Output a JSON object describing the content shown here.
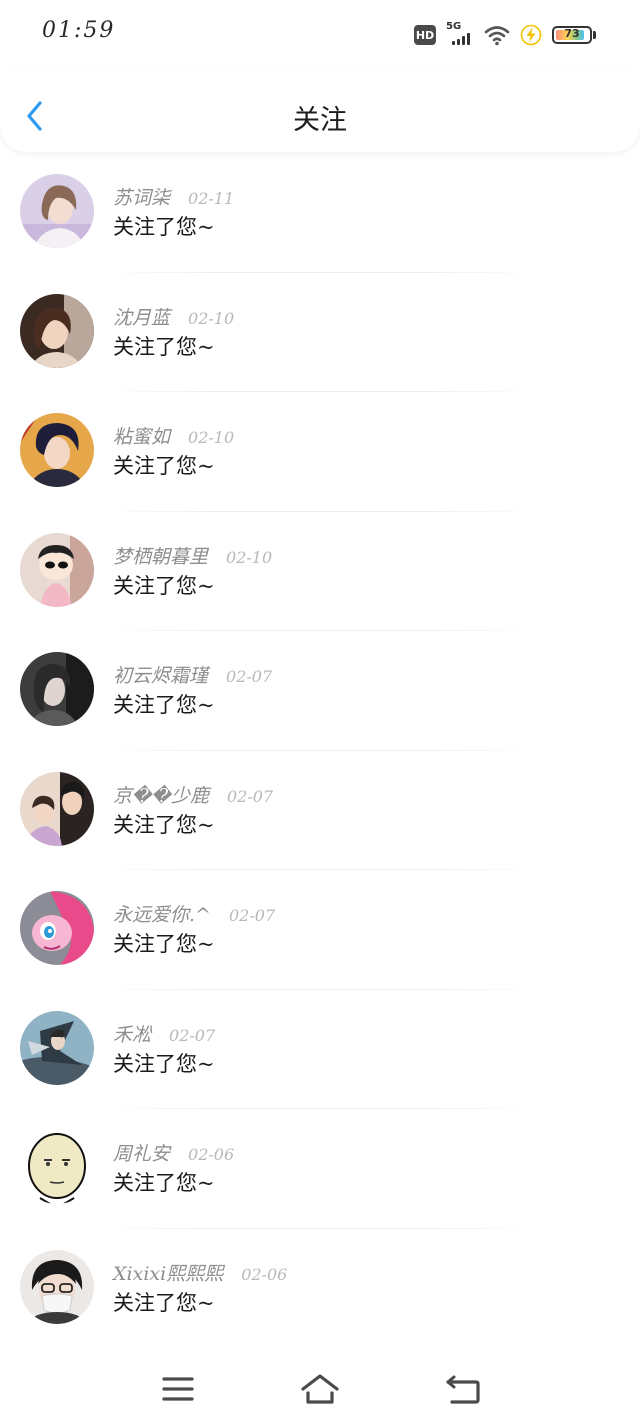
{
  "status_bar": {
    "time": "01:59",
    "hd": "HD",
    "network": "5G",
    "battery": "73",
    "battery_level": 0.73,
    "icons": [
      "hd-icon",
      "signal-icon",
      "wifi-icon",
      "charging-icon",
      "battery-icon"
    ]
  },
  "header": {
    "title": "关注",
    "back_icon": "chevron-left-icon",
    "accent_color": "#2e9bf0"
  },
  "list": {
    "items": [
      {
        "name": "苏词柒",
        "date": "02-11",
        "message": "关注了您~"
      },
      {
        "name": "沈月蓝",
        "date": "02-10",
        "message": "关注了您~"
      },
      {
        "name": "粘蜜如",
        "date": "02-10",
        "message": "关注了您~"
      },
      {
        "name": "梦栖朝暮里",
        "date": "02-10",
        "message": "关注了您~"
      },
      {
        "name": "初云烬霜瑾",
        "date": "02-07",
        "message": "关注了您~"
      },
      {
        "name": "京��少鹿",
        "date": "02-07",
        "message": "关注了您~"
      },
      {
        "name": "永远爱你.^",
        "date": "02-07",
        "message": "关注了您~"
      },
      {
        "name": "禾凇",
        "date": "02-07",
        "message": "关注了您~"
      },
      {
        "name": "周礼安",
        "date": "02-06",
        "message": "关注了您~"
      },
      {
        "name": "Xixixi熙熙熙",
        "date": "02-06",
        "message": "关注了您~"
      }
    ]
  },
  "nav_bar": {
    "icons": [
      "menu-icon",
      "home-icon",
      "back-icon"
    ]
  }
}
